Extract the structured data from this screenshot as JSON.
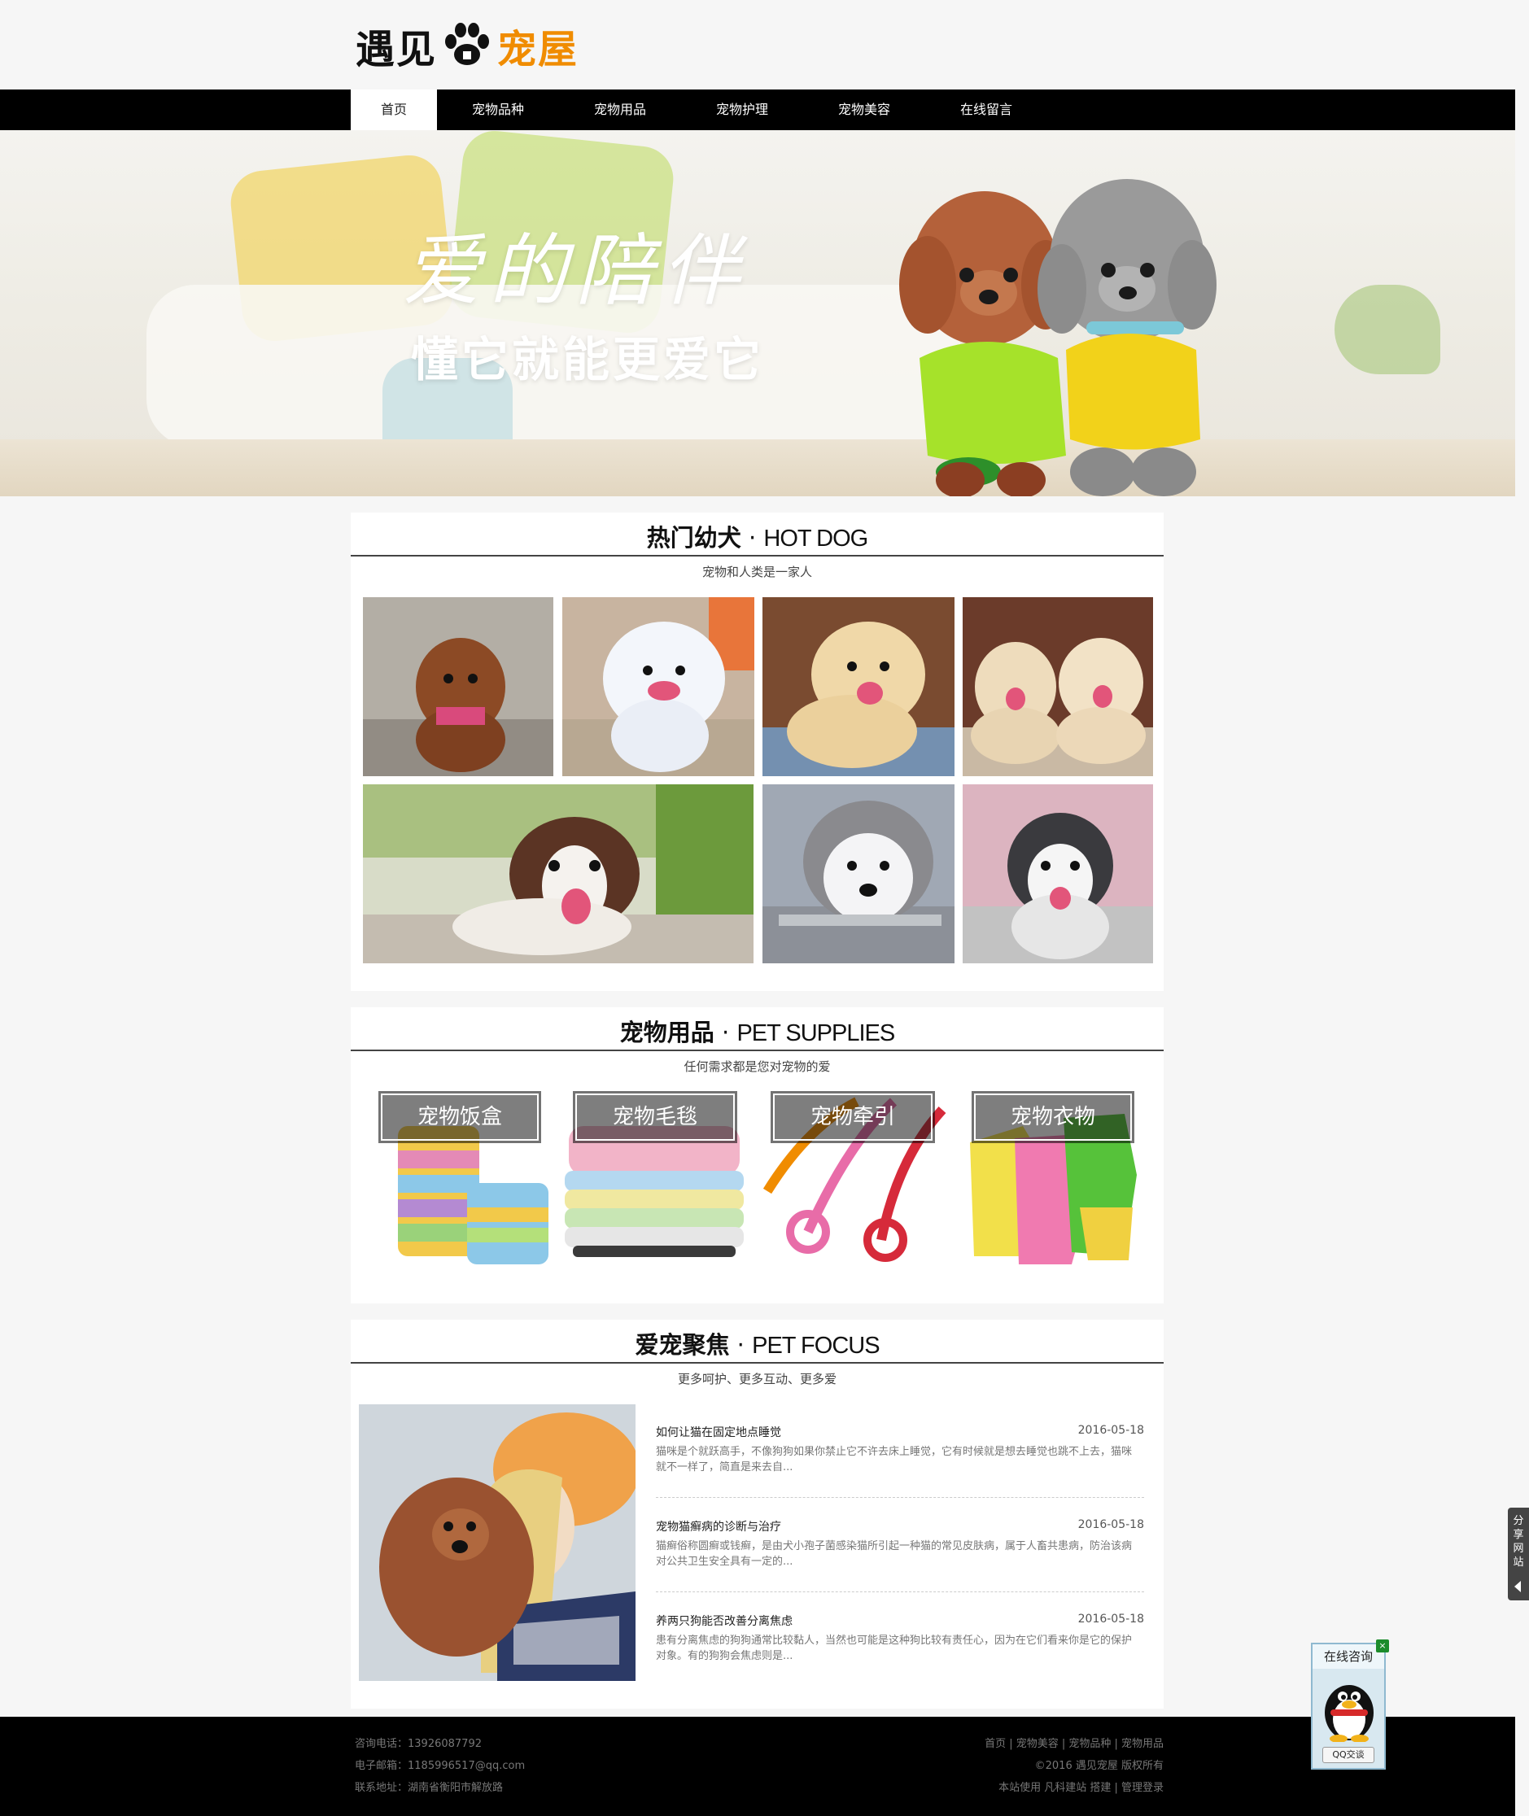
{
  "logo": {
    "part1": "遇见",
    "part2": "宠屋"
  },
  "nav": {
    "items": [
      "首页",
      "宠物品种",
      "宠物用品",
      "宠物护理",
      "宠物美容",
      "在线留言"
    ]
  },
  "banner": {
    "slogan_main": "爱的陪伴",
    "slogan_sub": "懂它就能更爱它"
  },
  "hot_dog": {
    "title_cn": "热门幼犬",
    "dot": "·",
    "title_en": "HOT DOG",
    "subtitle": "宠物和人类是一家人"
  },
  "supplies": {
    "title_cn": "宠物用品",
    "dot": "·",
    "title_en": "PET SUPPLIES",
    "subtitle": "任何需求都是您对宠物的爱",
    "items": [
      "宠物饭盒",
      "宠物毛毯",
      "宠物牵引",
      "宠物衣物"
    ]
  },
  "focus": {
    "title_cn": "爱宠聚焦",
    "dot": "·",
    "title_en": "PET FOCUS",
    "subtitle": "更多呵护、更多互动、更多爱",
    "articles": [
      {
        "title": "如何让猫在固定地点睡觉",
        "date": "2016-05-18",
        "desc": "猫咪是个就跃高手，不像狗狗如果你禁止它不许去床上睡觉，它有时候就是想去睡觉也跳不上去，猫咪就不一样了，简直是来去自..."
      },
      {
        "title": "宠物猫癣病的诊断与治疗",
        "date": "2016-05-18",
        "desc": "猫癣俗称圆癣或钱癣，是由犬小孢子菌感染猫所引起一种猫的常见皮肤病，属于人畜共患病，防治该病对公共卫生安全具有一定的..."
      },
      {
        "title": "养两只狗能否改善分离焦虑",
        "date": "2016-05-18",
        "desc": "患有分离焦虑的狗狗通常比较黏人，当然也可能是这种狗比较有责任心，因为在它们看来你是它的保护对象。有的狗狗会焦虑则是..."
      }
    ]
  },
  "footer": {
    "phone": "咨询电话：13926087792",
    "email": "电子邮箱：1185996517@qq.com",
    "address": "联系地址：湖南省衡阳市解放路",
    "links": "首页 | 宠物美容 | 宠物品种 | 宠物用品",
    "copyright": "©2016 遇见宠屋 版权所有",
    "powered": "本站使用 凡科建站 搭建 | 管理登录"
  },
  "share": {
    "label": "分享网站"
  },
  "qq": {
    "title": "在线咨询",
    "close": "×",
    "button": "QQ交谈"
  },
  "colors": {
    "nav_bg": "#000000",
    "accent": "#f08c00",
    "footer_bg": "#000000"
  }
}
